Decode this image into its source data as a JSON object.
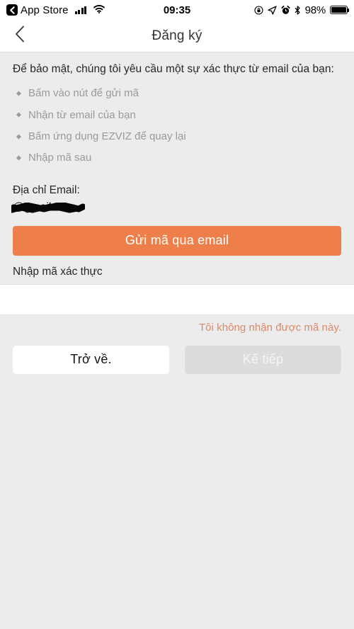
{
  "status_bar": {
    "back_app_label": "App Store",
    "back_app_icon": "chevron-left-icon",
    "signal_icon": "cellular-signal-icon",
    "wifi_icon": "wifi-icon",
    "time": "09:35",
    "rotation_lock_icon": "rotation-lock-icon",
    "location_icon": "location-arrow-icon",
    "alarm_icon": "alarm-clock-icon",
    "bluetooth_icon": "bluetooth-icon",
    "battery_percent": "98%",
    "battery_icon": "battery-icon"
  },
  "nav": {
    "back_icon": "chevron-left-icon",
    "title": "Đăng ký"
  },
  "main": {
    "intro": "Để bảo mật, chúng tôi yêu cầu một sự xác thực từ email của bạn:",
    "steps": [
      "Bấm vào nút để gửi mã",
      "Nhận từ email của bạn",
      "Bấm ứng dụng EZVIZ để quay lại",
      "Nhập mã sau"
    ],
    "email_label": "Địa chỉ Email:",
    "email_value": "@gmail.com",
    "email_redacted": true,
    "send_code_button": "Gửi mã qua email",
    "code_label": "Nhập mã xác thực",
    "code_value": "",
    "code_placeholder": "",
    "resend_link": "Tôi không nhận được mã này.",
    "back_button": "Trở về.",
    "next_button": "Kế tiếp",
    "next_button_disabled": true
  },
  "colors": {
    "accent_orange": "#ee7f4a",
    "link_orange": "#d98a6a",
    "page_background": "#ececec",
    "disabled_gray": "#dcdcdc"
  }
}
